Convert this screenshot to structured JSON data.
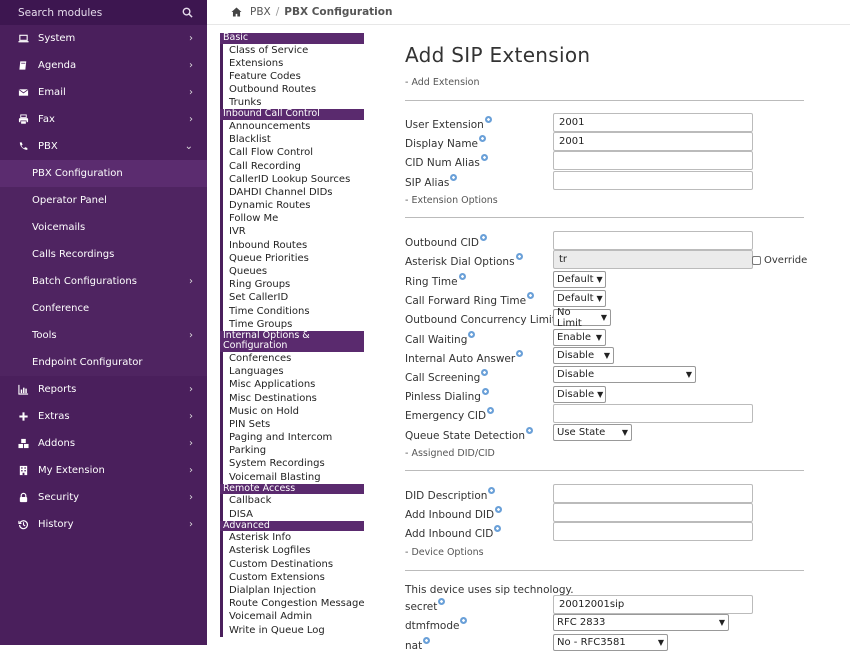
{
  "sidebar": {
    "search_placeholder": "Search modules",
    "items": [
      {
        "label": "System",
        "icon": "laptop-icon",
        "chevron": "›"
      },
      {
        "label": "Agenda",
        "icon": "book-icon",
        "chevron": "›"
      },
      {
        "label": "Email",
        "icon": "envelope-icon",
        "chevron": "›"
      },
      {
        "label": "Fax",
        "icon": "printer-icon",
        "chevron": "›"
      },
      {
        "label": "PBX",
        "icon": "phone-icon",
        "chevron": "⌄"
      }
    ],
    "pbx_sub": [
      {
        "label": "PBX Configuration",
        "chevron": ""
      },
      {
        "label": "Operator Panel",
        "chevron": ""
      },
      {
        "label": "Voicemails",
        "chevron": ""
      },
      {
        "label": "Calls Recordings",
        "chevron": ""
      },
      {
        "label": "Batch Configurations",
        "chevron": "›"
      },
      {
        "label": "Conference",
        "chevron": ""
      },
      {
        "label": "Tools",
        "chevron": "›"
      },
      {
        "label": "Endpoint Configurator",
        "chevron": ""
      }
    ],
    "items2": [
      {
        "label": "Reports",
        "icon": "chart-icon",
        "chevron": "›"
      },
      {
        "label": "Extras",
        "icon": "plus-icon",
        "chevron": "›"
      },
      {
        "label": "Addons",
        "icon": "cubes-icon",
        "chevron": "›"
      },
      {
        "label": "My Extension",
        "icon": "building-icon",
        "chevron": "›"
      },
      {
        "label": "Security",
        "icon": "lock-icon",
        "chevron": "›"
      },
      {
        "label": "History",
        "icon": "history-icon",
        "chevron": "›"
      }
    ]
  },
  "breadcrumb": {
    "root": "PBX",
    "separator": "/",
    "current": "PBX Configuration"
  },
  "modules": [
    {
      "head": "Basic"
    },
    {
      "item": "Class of Service"
    },
    {
      "item": "Extensions"
    },
    {
      "item": "Feature Codes"
    },
    {
      "item": "Outbound Routes"
    },
    {
      "item": "Trunks"
    },
    {
      "head": "Inbound Call Control"
    },
    {
      "item": "Announcements"
    },
    {
      "item": "Blacklist"
    },
    {
      "item": "Call Flow Control"
    },
    {
      "item": "Call Recording"
    },
    {
      "item": "CallerID Lookup Sources"
    },
    {
      "item": "DAHDI Channel DIDs"
    },
    {
      "item": "Dynamic Routes"
    },
    {
      "item": "Follow Me"
    },
    {
      "item": "IVR"
    },
    {
      "item": "Inbound Routes"
    },
    {
      "item": "Queue Priorities"
    },
    {
      "item": "Queues"
    },
    {
      "item": "Ring Groups"
    },
    {
      "item": "Set CallerID"
    },
    {
      "item": "Time Conditions"
    },
    {
      "item": "Time Groups"
    },
    {
      "head": "Internal Options & Configuration"
    },
    {
      "item": "Conferences"
    },
    {
      "item": "Languages"
    },
    {
      "item": "Misc Applications"
    },
    {
      "item": "Misc Destinations"
    },
    {
      "item": "Music on Hold"
    },
    {
      "item": "PIN Sets"
    },
    {
      "item": "Paging and Intercom"
    },
    {
      "item": "Parking"
    },
    {
      "item": "System Recordings"
    },
    {
      "item": "Voicemail Blasting"
    },
    {
      "head": "Remote Access"
    },
    {
      "item": "Callback"
    },
    {
      "item": "DISA"
    },
    {
      "head": "Advanced"
    },
    {
      "item": "Asterisk Info"
    },
    {
      "item": "Asterisk Logfiles"
    },
    {
      "item": "Custom Destinations"
    },
    {
      "item": "Custom Extensions"
    },
    {
      "item": "Dialplan Injection"
    },
    {
      "item": "Route Congestion Messages"
    },
    {
      "item": "Voicemail Admin"
    },
    {
      "item": "Write in Queue Log"
    }
  ],
  "form": {
    "title": "Add SIP Extension",
    "sections": {
      "add_extension": "- Add Extension",
      "extension_options": "- Extension Options",
      "assigned_did": "- Assigned DID/CID",
      "device_options": "- Device Options"
    },
    "fields": {
      "user_extension": {
        "label": "User Extension",
        "value": "2001"
      },
      "display_name": {
        "label": "Display Name",
        "value": "2001"
      },
      "cid_num_alias": {
        "label": "CID Num Alias",
        "value": ""
      },
      "sip_alias": {
        "label": "SIP Alias",
        "value": ""
      },
      "outbound_cid": {
        "label": "Outbound CID",
        "value": ""
      },
      "asterisk_dial_options": {
        "label": "Asterisk Dial Options",
        "value": "tr",
        "override_label": "Override"
      },
      "ring_time": {
        "label": "Ring Time",
        "value": "Default"
      },
      "call_forward_ring_time": {
        "label": "Call Forward Ring Time",
        "value": "Default"
      },
      "outbound_concurrency_limit": {
        "label": "Outbound Concurrency Limit",
        "value": "No Limit"
      },
      "call_waiting": {
        "label": "Call Waiting",
        "value": "Enable"
      },
      "internal_auto_answer": {
        "label": "Internal Auto Answer",
        "value": "Disable"
      },
      "call_screening": {
        "label": "Call Screening",
        "value": "Disable"
      },
      "pinless_dialing": {
        "label": "Pinless Dialing",
        "value": "Disable"
      },
      "emergency_cid": {
        "label": "Emergency CID",
        "value": ""
      },
      "queue_state_detection": {
        "label": "Queue State Detection",
        "value": "Use State"
      },
      "did_description": {
        "label": "DID Description",
        "value": ""
      },
      "add_inbound_did": {
        "label": "Add Inbound DID",
        "value": ""
      },
      "add_inbound_cid": {
        "label": "Add Inbound CID",
        "value": ""
      },
      "technology_note": "This device uses sip technology.",
      "secret": {
        "label": "secret",
        "value": "20012001sip"
      },
      "dtmfmode": {
        "label": "dtmfmode",
        "value": "RFC 2833"
      },
      "nat": {
        "label": "nat",
        "value": "No - RFC3581"
      }
    }
  }
}
